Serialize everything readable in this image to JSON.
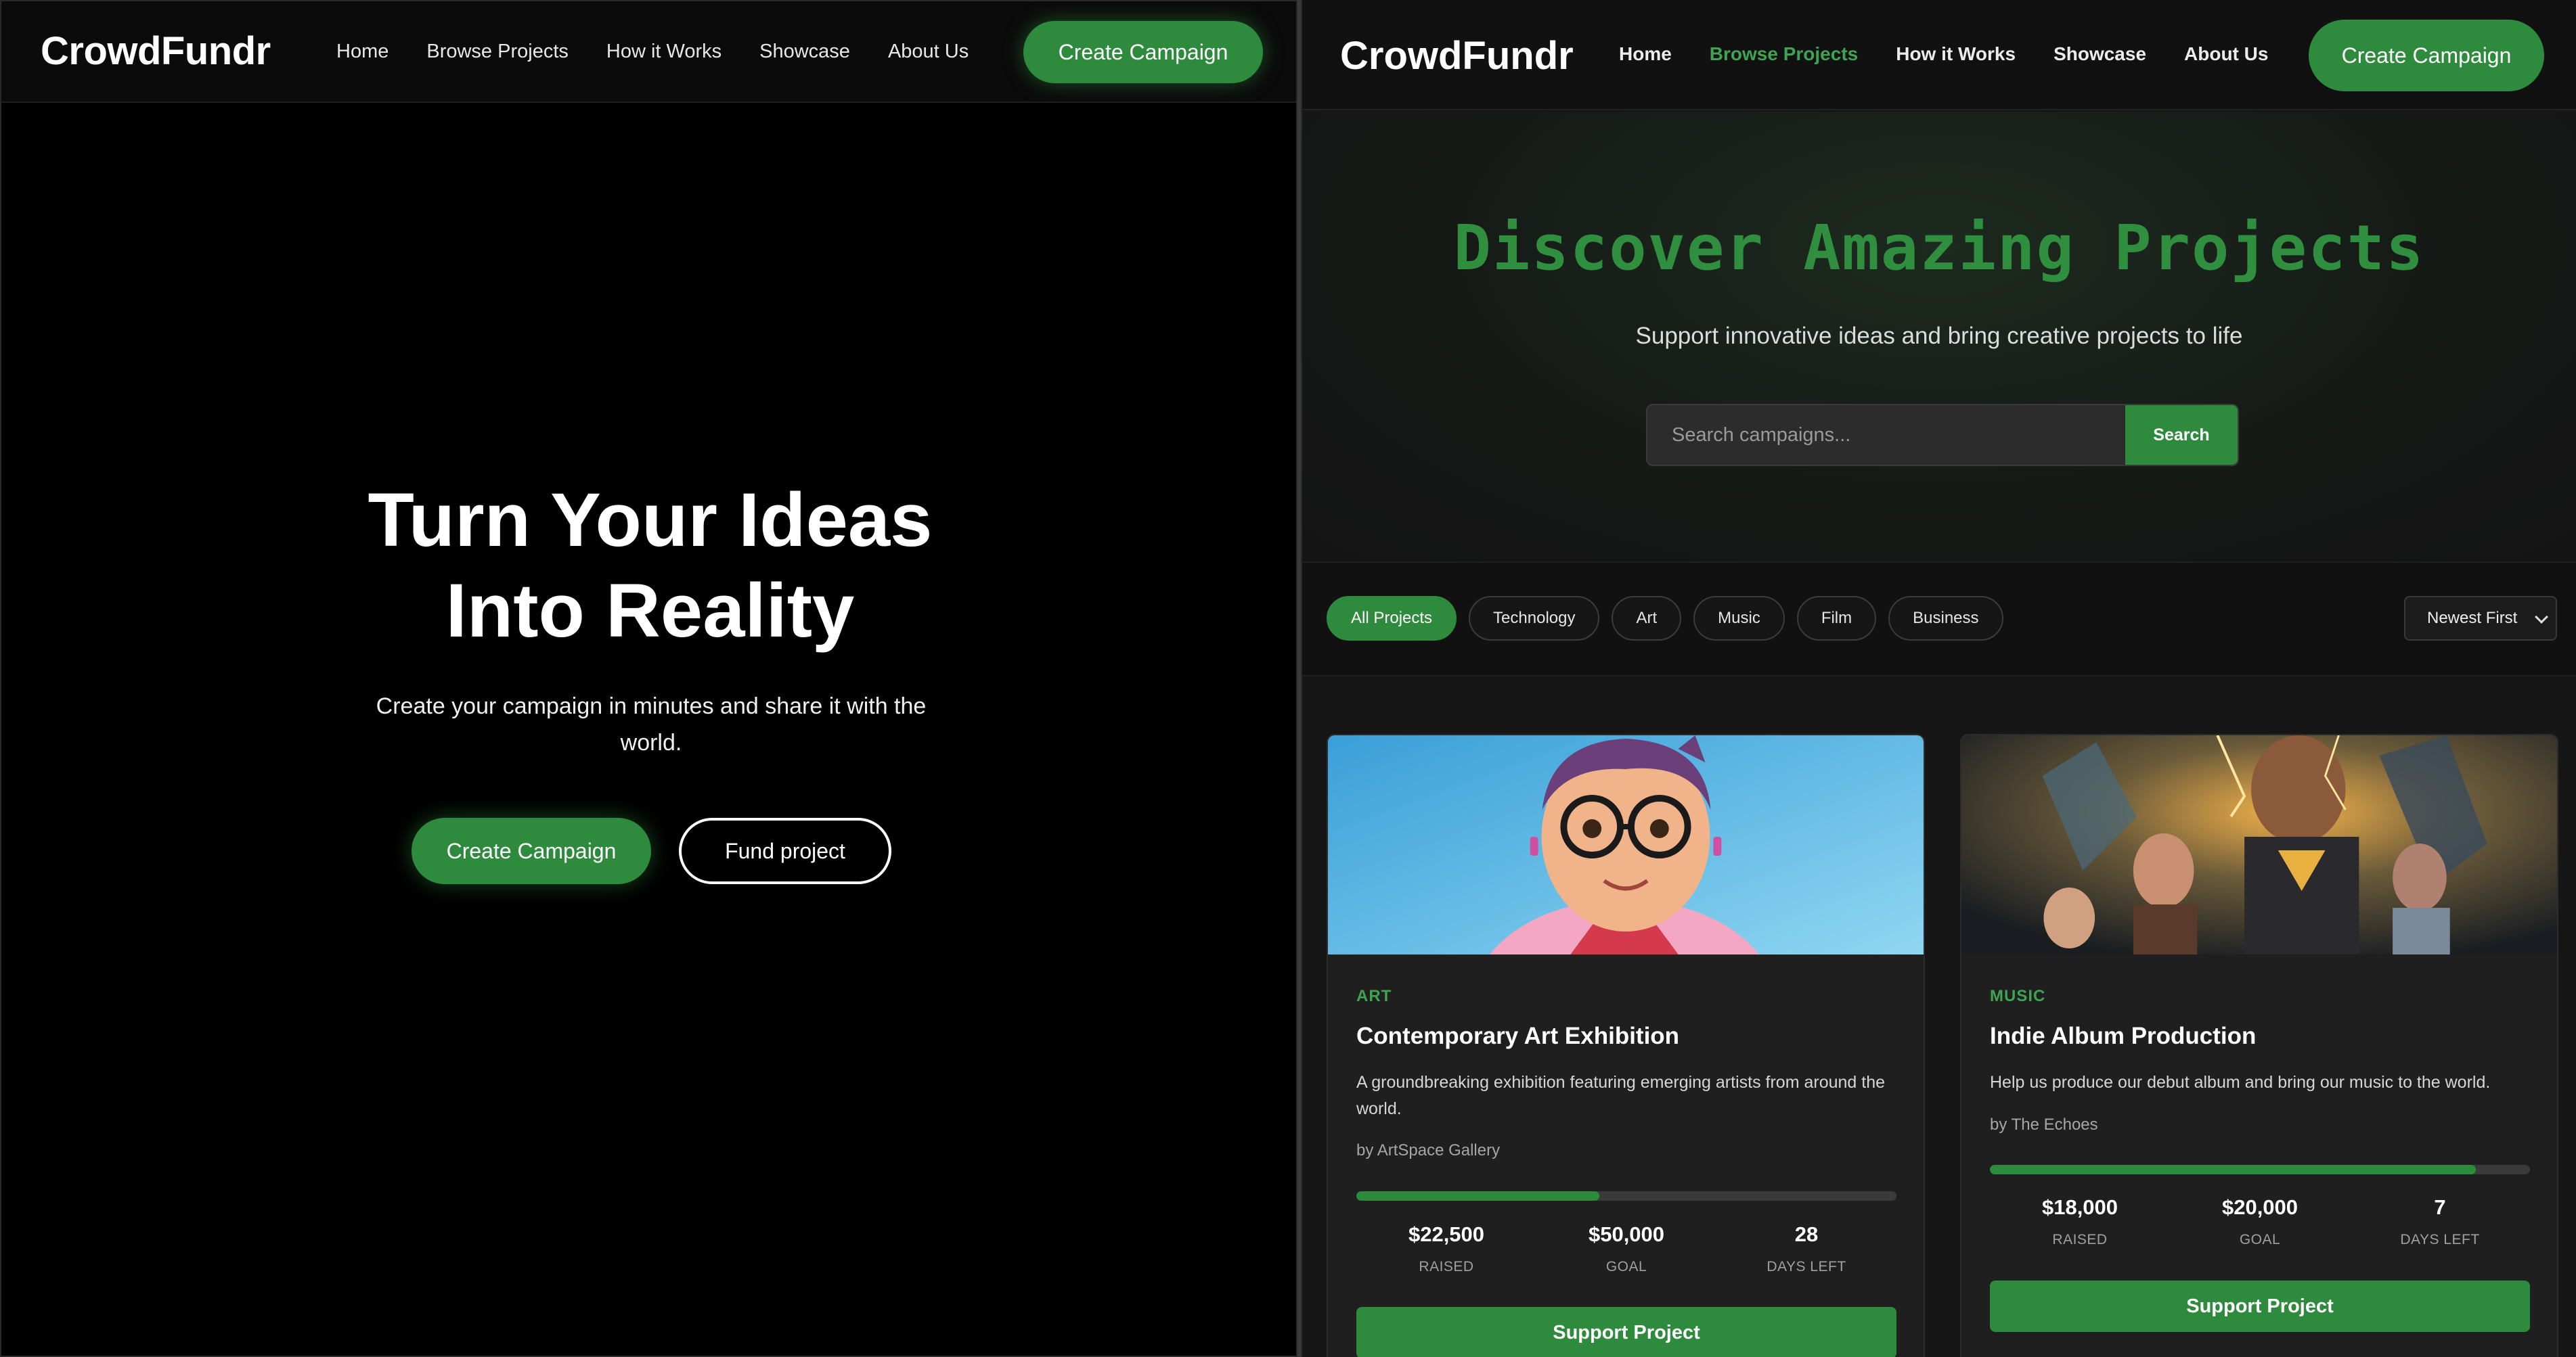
{
  "left": {
    "nav": {
      "logo": "CrowdFundr",
      "links": [
        "Home",
        "Browse Projects",
        "How it Works",
        "Showcase",
        "About Us"
      ],
      "cta": "Create Campaign"
    },
    "hero": {
      "title_line1": "Turn Your Ideas",
      "title_line2": "Into Reality",
      "subtitle": "Create your campaign in minutes and share it with the world.",
      "primary_button": "Create Campaign",
      "secondary_button": "Fund project"
    }
  },
  "right": {
    "nav": {
      "logo": "CrowdFundr",
      "links": [
        "Home",
        "Browse Projects",
        "How it Works",
        "Showcase",
        "About Us"
      ],
      "active_link": "Browse Projects",
      "cta": "Create Campaign"
    },
    "hero": {
      "title": "Discover Amazing Projects",
      "subtitle": "Support innovative ideas and bring creative projects to life",
      "search_placeholder": "Search campaigns...",
      "search_button": "Search"
    },
    "filters": {
      "chips": [
        "All Projects",
        "Technology",
        "Art",
        "Music",
        "Film",
        "Business"
      ],
      "active_chip": "All Projects",
      "sort_selected": "Newest First"
    },
    "cards": [
      {
        "category": "ART",
        "title": "Contemporary Art Exhibition",
        "description": "A groundbreaking exhibition featuring emerging artists from around the world.",
        "by": "by ArtSpace Gallery",
        "progress": 0.45,
        "raised": "$22,500",
        "raised_label": "RAISED",
        "goal": "$50,000",
        "goal_label": "GOAL",
        "days": "28",
        "days_label": "DAYS LEFT",
        "button": "Support Project",
        "image": "cartoon-woman-with-glasses-illustration"
      },
      {
        "category": "MUSIC",
        "title": "Indie Album Production",
        "description": "Help us produce our debut album and bring our music to the world.",
        "by": "by The Echoes",
        "progress": 0.9,
        "raised": "$18,000",
        "raised_label": "RAISED",
        "goal": "$20,000",
        "goal_label": "GOAL",
        "days": "7",
        "days_label": "DAYS LEFT",
        "button": "Support Project",
        "image": "movie-poster-group-of-superheroes"
      }
    ]
  },
  "colors": {
    "accent": "#2e8b3d",
    "accent_text": "#3fa451"
  }
}
